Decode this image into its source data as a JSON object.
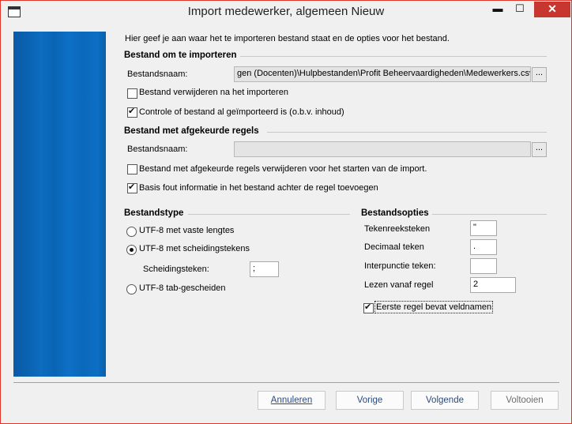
{
  "window": {
    "title": "Import medewerker, algemeen Nieuw",
    "controls": {
      "minimize": "▬",
      "maximize": "☐",
      "close": "✕"
    }
  },
  "intro": "Hier geef je aan waar het te importeren bestand staat en de opties voor het bestand.",
  "import_file": {
    "heading": "Bestand om te importeren",
    "filename_label": "Bestandsnaam:",
    "filename_value": "gen (Docenten)\\Hulpbestanden\\Profit Beheervaardigheden\\Medewerkers.csv",
    "browse_label": "...",
    "delete_after": {
      "label": "Bestand verwijderen na het importeren",
      "checked": false
    },
    "check_imported": {
      "label": "Controle of bestand al geïmporteerd is (o.b.v. inhoud)",
      "checked": true
    }
  },
  "rejected_file": {
    "heading": "Bestand met afgekeurde regels",
    "filename_label": "Bestandsnaam:",
    "filename_value": "",
    "browse_label": "...",
    "delete_before": {
      "label": "Bestand met afgekeurde regels verwijderen voor het starten van de import.",
      "checked": false
    },
    "append_error": {
      "label": "Basis fout informatie in het bestand achter de regel toevoegen",
      "checked": true
    }
  },
  "file_type": {
    "heading": "Bestandstype",
    "options": [
      {
        "label": "UTF-8 met vaste lengtes",
        "selected": false
      },
      {
        "label": "UTF-8 met scheidingstekens",
        "selected": true
      },
      {
        "label": "UTF-8 tab-gescheiden",
        "selected": false
      }
    ],
    "separator_label": "Scheidingsteken:",
    "separator_value": ";"
  },
  "file_options": {
    "heading": "Bestandsopties",
    "string_char_label": "Tekenreeksteken",
    "string_char_value": "\"",
    "decimal_label": "Decimaal teken",
    "decimal_value": ".",
    "punct_label": "Interpunctie teken:",
    "punct_value": "",
    "start_row_label": "Lezen vanaf regel",
    "start_row_value": "2",
    "header_row": {
      "label": "Eerste regel bevat veldnamen",
      "checked": true
    }
  },
  "buttons": {
    "cancel": "Annuleren",
    "previous": "Vorige",
    "next": "Volgende",
    "finish": "Voltooien"
  },
  "colors": {
    "banner": "#0a62b0",
    "close_button": "#c7372f"
  }
}
